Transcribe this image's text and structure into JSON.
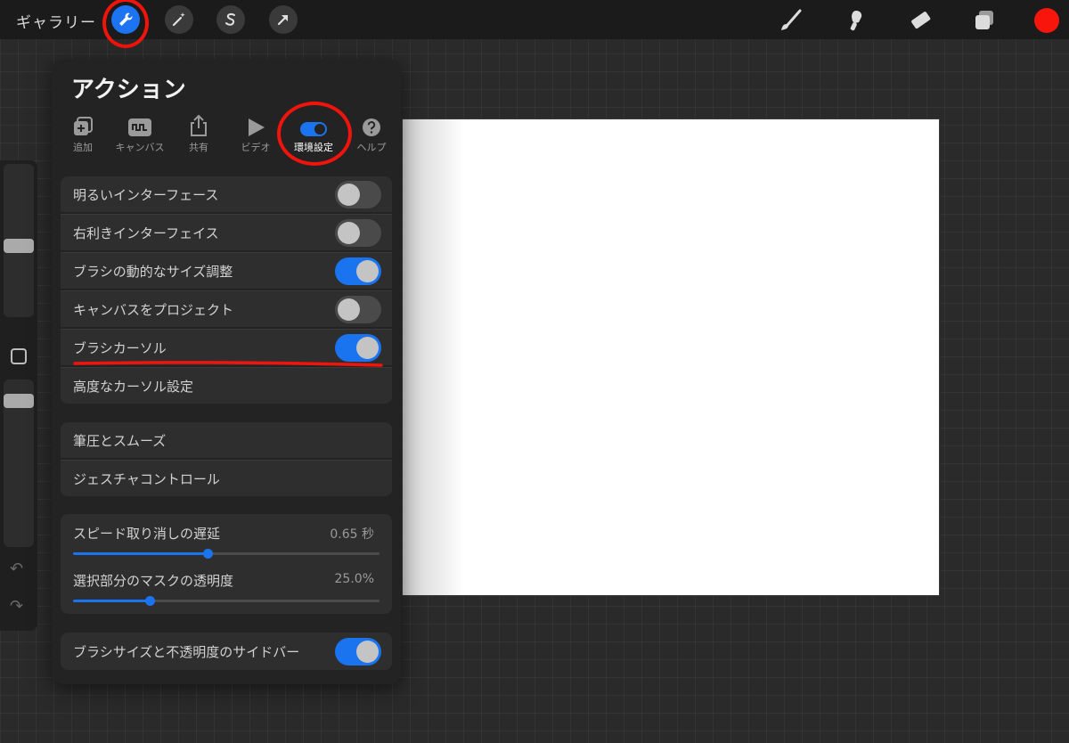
{
  "topbar": {
    "gallery_label": "ギャラリー",
    "tools_left": [
      "wrench-icon",
      "magic-wand-icon",
      "selection-s-icon",
      "arrow-transform-icon"
    ],
    "tools_right": [
      "brush-icon",
      "smudge-icon",
      "eraser-icon",
      "layers-icon"
    ],
    "color": "#f7150c"
  },
  "panel": {
    "title": "アクション",
    "tabs": [
      {
        "label": "追加"
      },
      {
        "label": "キャンバス"
      },
      {
        "label": "共有"
      },
      {
        "label": "ビデオ"
      },
      {
        "label": "環境設定"
      },
      {
        "label": "ヘルプ"
      }
    ],
    "toggles": [
      {
        "label": "明るいインターフェース",
        "on": false
      },
      {
        "label": "右利きインターフェイス",
        "on": false
      },
      {
        "label": "ブラシの動的なサイズ調整",
        "on": true
      },
      {
        "label": "キャンバスをプロジェクト",
        "on": false
      },
      {
        "label": "ブラシカーソル",
        "on": true
      }
    ],
    "advanced_cursor": "高度なカーソル設定",
    "links": [
      "筆圧とスムーズ",
      "ジェスチャコントロール"
    ],
    "sliders": [
      {
        "label": "スピード取り消しの遅延",
        "value": "0.65 秒",
        "fraction": 0.44
      },
      {
        "label": "選択部分のマスクの透明度",
        "value": "25.0%",
        "fraction": 0.25
      }
    ],
    "sidebar_toggle": {
      "label": "ブラシサイズと不透明度のサイドバー",
      "on": true
    }
  },
  "colors": {
    "accent": "#1a74f0",
    "annotation": "#f0140c"
  }
}
